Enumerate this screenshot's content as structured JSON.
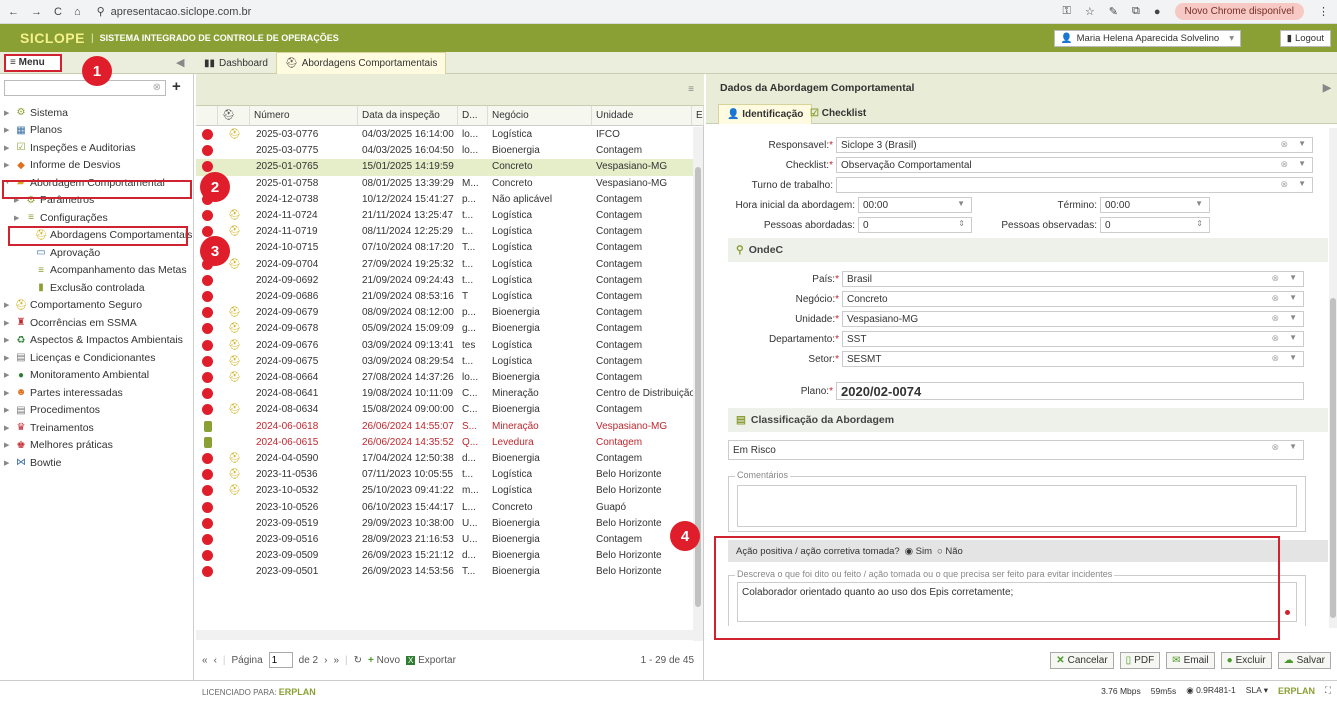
{
  "browser": {
    "url": "apresentacao.siclope.com.br",
    "new_chrome": "Novo Chrome disponível"
  },
  "app": {
    "logo": "SICLOPE",
    "title": "SISTEMA INTEGRADO DE CONTROLE DE OPERAÇÕES",
    "user": "Maria Helena Aparecida Solvelino",
    "logout": "Logout"
  },
  "tabs": {
    "menu": "Menu",
    "dashboard": "Dashboard",
    "abordagens": "Abordagens Comportamentais"
  },
  "annotations": [
    "1",
    "2",
    "3",
    "4"
  ],
  "sidebar": [
    {
      "label": "Sistema",
      "icon": "gear-icon",
      "level": 0
    },
    {
      "label": "Planos",
      "icon": "calendar-icon",
      "level": 0
    },
    {
      "label": "Inspeções e Auditorias",
      "icon": "checklist-icon",
      "level": 0
    },
    {
      "label": "Informe de Desvios",
      "icon": "diamond-icon",
      "level": 0
    },
    {
      "label": "Abordagem Comportamental",
      "icon": "folder-icon",
      "level": 0
    },
    {
      "label": "Parâmetros",
      "icon": "gear-icon",
      "level": 1
    },
    {
      "label": "Configurações",
      "icon": "list-icon",
      "level": 1
    },
    {
      "label": "Abordagens Comportamentais",
      "icon": "helmet-icon",
      "level": 2
    },
    {
      "label": "Aprovação",
      "icon": "approve-icon",
      "level": 2
    },
    {
      "label": "Acompanhamento das Metas",
      "icon": "list-icon",
      "level": 2
    },
    {
      "label": "Exclusão controlada",
      "icon": "trash-icon",
      "level": 2
    },
    {
      "label": "Comportamento Seguro",
      "icon": "helmet-icon",
      "level": 0
    },
    {
      "label": "Ocorrências em SSMA",
      "icon": "person-icon",
      "level": 0
    },
    {
      "label": "Aspectos & Impactos Ambientais",
      "icon": "recycle-icon",
      "level": 0
    },
    {
      "label": "Licenças e Condicionantes",
      "icon": "doc-icon",
      "level": 0
    },
    {
      "label": "Monitoramento Ambiental",
      "icon": "tree-icon",
      "level": 0
    },
    {
      "label": "Partes interessadas",
      "icon": "people-icon",
      "level": 0
    },
    {
      "label": "Procedimentos",
      "icon": "doc-icon",
      "level": 0
    },
    {
      "label": "Treinamentos",
      "icon": "trophy-icon",
      "level": 0
    },
    {
      "label": "Melhores práticas",
      "icon": "medal-icon",
      "level": 0
    },
    {
      "label": "Bowtie",
      "icon": "bowtie-icon",
      "level": 0
    }
  ],
  "grid": {
    "columns": [
      "Número",
      "Data da inspeção",
      "D...",
      "Negócio",
      "Unidade",
      "E"
    ],
    "rows": [
      {
        "helmet": true,
        "numero": "2025-03-0776",
        "data": "04/03/2025 16:14:00",
        "d": "lo...",
        "negocio": "Logística",
        "unidade": "IFCO",
        "status": "red"
      },
      {
        "helmet": false,
        "numero": "2025-03-0775",
        "data": "04/03/2025 16:04:50",
        "d": "lo...",
        "negocio": "Bioenergia",
        "unidade": "Contagem",
        "status": "red"
      },
      {
        "helmet": false,
        "numero": "2025-01-0765",
        "data": "15/01/2025 14:19:59",
        "d": "",
        "negocio": "Concreto",
        "unidade": "Vespasiano-MG",
        "status": "red",
        "selected": true
      },
      {
        "helmet": false,
        "numero": "2025-01-0758",
        "data": "08/01/2025 13:39:29",
        "d": "M...",
        "negocio": "Concreto",
        "unidade": "Vespasiano-MG",
        "status": "red"
      },
      {
        "helmet": false,
        "numero": "2024-12-0738",
        "data": "10/12/2024 15:41:27",
        "d": "p...",
        "negocio": "Não aplicável",
        "unidade": "Contagem",
        "status": "red"
      },
      {
        "helmet": true,
        "numero": "2024-11-0724",
        "data": "21/11/2024 13:25:47",
        "d": "t...",
        "negocio": "Logística",
        "unidade": "Contagem",
        "status": "red"
      },
      {
        "helmet": true,
        "numero": "2024-11-0719",
        "data": "08/11/2024 12:25:29",
        "d": "t...",
        "negocio": "Logística",
        "unidade": "Contagem",
        "status": "red"
      },
      {
        "helmet": false,
        "numero": "2024-10-0715",
        "data": "07/10/2024 08:17:20",
        "d": "T...",
        "negocio": "Logística",
        "unidade": "Contagem",
        "status": "red"
      },
      {
        "helmet": true,
        "numero": "2024-09-0704",
        "data": "27/09/2024 19:25:32",
        "d": "t...",
        "negocio": "Logística",
        "unidade": "Contagem",
        "status": "red"
      },
      {
        "helmet": false,
        "numero": "2024-09-0692",
        "data": "21/09/2024 09:24:43",
        "d": "t...",
        "negocio": "Logística",
        "unidade": "Contagem",
        "status": "red"
      },
      {
        "helmet": false,
        "numero": "2024-09-0686",
        "data": "21/09/2024 08:53:16",
        "d": "T",
        "negocio": "Logística",
        "unidade": "Contagem",
        "status": "red"
      },
      {
        "helmet": true,
        "numero": "2024-09-0679",
        "data": "08/09/2024 08:12:00",
        "d": "p...",
        "negocio": "Bioenergia",
        "unidade": "Contagem",
        "status": "red"
      },
      {
        "helmet": true,
        "numero": "2024-09-0678",
        "data": "05/09/2024 15:09:09",
        "d": "g...",
        "negocio": "Bioenergia",
        "unidade": "Contagem",
        "status": "red"
      },
      {
        "helmet": true,
        "numero": "2024-09-0676",
        "data": "03/09/2024 09:13:41",
        "d": "tes",
        "negocio": "Logística",
        "unidade": "Contagem",
        "status": "red"
      },
      {
        "helmet": true,
        "numero": "2024-09-0675",
        "data": "03/09/2024 08:29:54",
        "d": "t...",
        "negocio": "Logística",
        "unidade": "Contagem",
        "status": "red"
      },
      {
        "helmet": true,
        "numero": "2024-08-0664",
        "data": "27/08/2024 14:37:26",
        "d": "lo...",
        "negocio": "Bioenergia",
        "unidade": "Contagem",
        "status": "red"
      },
      {
        "helmet": false,
        "numero": "2024-08-0641",
        "data": "19/08/2024 10:11:09",
        "d": "C...",
        "negocio": "Mineração",
        "unidade": "Centro de Distribuição",
        "status": "red"
      },
      {
        "helmet": true,
        "numero": "2024-08-0634",
        "data": "15/08/2024 09:00:00",
        "d": "C...",
        "negocio": "Bioenergia",
        "unidade": "Contagem",
        "status": "red"
      },
      {
        "helmet": false,
        "numero": "2024-06-0618",
        "data": "26/06/2024 14:55:07",
        "d": "S...",
        "negocio": "Mineração",
        "unidade": "Vespasiano-MG",
        "status": "green",
        "red_text": true
      },
      {
        "helmet": false,
        "numero": "2024-06-0615",
        "data": "26/06/2024 14:35:52",
        "d": "Q...",
        "negocio": "Levedura",
        "unidade": "Contagem",
        "status": "green",
        "red_text": true
      },
      {
        "helmet": true,
        "numero": "2024-04-0590",
        "data": "17/04/2024 12:50:38",
        "d": "d...",
        "negocio": "Bioenergia",
        "unidade": "Contagem",
        "status": "red"
      },
      {
        "helmet": true,
        "numero": "2023-11-0536",
        "data": "07/11/2023 10:05:55",
        "d": "t...",
        "negocio": "Logística",
        "unidade": "Belo Horizonte",
        "status": "red"
      },
      {
        "helmet": true,
        "numero": "2023-10-0532",
        "data": "25/10/2023 09:41:22",
        "d": "m...",
        "negocio": "Logística",
        "unidade": "Belo Horizonte",
        "status": "red"
      },
      {
        "helmet": false,
        "numero": "2023-10-0526",
        "data": "06/10/2023 15:44:17",
        "d": "L...",
        "negocio": "Concreto",
        "unidade": "Guapó",
        "status": "red"
      },
      {
        "helmet": false,
        "numero": "2023-09-0519",
        "data": "29/09/2023 10:38:00",
        "d": "U...",
        "negocio": "Bioenergia",
        "unidade": "Belo Horizonte",
        "status": "red"
      },
      {
        "helmet": false,
        "numero": "2023-09-0516",
        "data": "28/09/2023 21:16:53",
        "d": "U...",
        "negocio": "Bioenergia",
        "unidade": "Contagem",
        "status": "red"
      },
      {
        "helmet": false,
        "numero": "2023-09-0509",
        "data": "26/09/2023 15:21:12",
        "d": "d...",
        "negocio": "Bioenergia",
        "unidade": "Belo Horizonte",
        "status": "red"
      },
      {
        "helmet": false,
        "numero": "2023-09-0501",
        "data": "26/09/2023 14:53:56",
        "d": "T...",
        "negocio": "Bioenergia",
        "unidade": "Belo Horizonte",
        "status": "red"
      }
    ],
    "pager": {
      "page_label": "Página",
      "page": "1",
      "of": "de 2",
      "novo": "Novo",
      "exportar": "Exportar",
      "count": "1 - 29 de 45"
    }
  },
  "detail": {
    "title": "Dados da Abordagem Comportamental",
    "tab_identificacao": "Identificação",
    "tab_checklist": "Checklist",
    "responsavel_label": "Responsavel:",
    "responsavel": "Siclope 3 (Brasil)",
    "checklist_label": "Checklist:",
    "checklist": "Observação Comportamental",
    "turno_label": "Turno de trabalho:",
    "turno": "",
    "hora_label": "Hora inicial da abordagem:",
    "hora": "00:00",
    "termino_label": "Término:",
    "termino": "00:00",
    "pessoas_ab_label": "Pessoas abordadas:",
    "pessoas_ab": "0",
    "pessoas_ob_label": "Pessoas observadas:",
    "pessoas_ob": "0",
    "onde_title": "OndeC",
    "pais_label": "País:",
    "pais": "Brasil",
    "negocio_label": "Negócio:",
    "negocio": "Concreto",
    "unidade_label": "Unidade:",
    "unidade": "Vespasiano-MG",
    "departamento_label": "Departamento:",
    "departamento": "SST",
    "setor_label": "Setor:",
    "setor": "SESMT",
    "plano_label": "Plano:",
    "plano": "2020/02-0074",
    "class_title": "Classificação da Abordagem",
    "classificacao": "Em Risco",
    "comentarios_legend": "Comentários",
    "acao_label": "Ação positiva / ação corretiva tomada?",
    "sim": "Sim",
    "nao": "Não",
    "descreva_legend": "Descreva o que foi dito ou feito / ação tomada ou o que precisa ser feito para evitar incidentes",
    "descreva": "Colaborador orientado quanto ao uso dos Epis corretamente;",
    "buttons": {
      "cancelar": "Cancelar",
      "pdf": "PDF",
      "email": "Email",
      "excluir": "Excluir",
      "salvar": "Salvar"
    }
  },
  "footer": {
    "licenciado": "LICENCIADO PARA:",
    "erplan": "ERPLAN",
    "speed": "3.76 Mbps",
    "time": "59m5s",
    "version": "0.9R481-1",
    "sla": "SLA"
  }
}
